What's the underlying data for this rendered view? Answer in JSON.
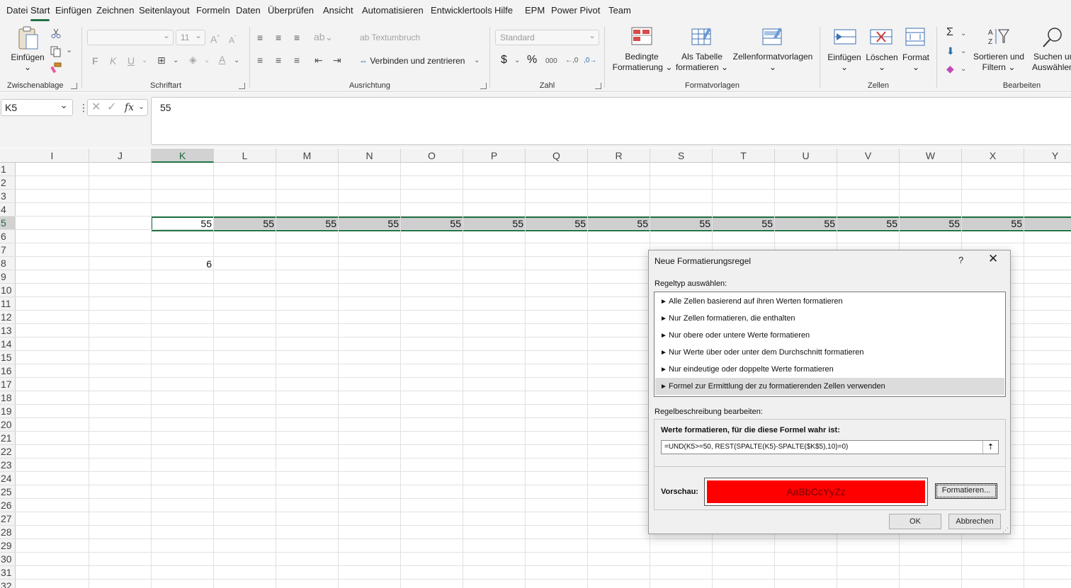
{
  "menu": {
    "tabs": [
      "Datei",
      "Start",
      "Einfügen",
      "Zeichnen",
      "Seitenlayout",
      "Formeln",
      "Daten",
      "Überprüfen",
      "Ansicht",
      "Automatisieren",
      "Entwicklertools",
      "Hilfe",
      "EPM",
      "Power Pivot",
      "Team"
    ],
    "active": "Start"
  },
  "ribbon": {
    "clipboard": {
      "paste": "Einfügen",
      "label": "Zwischenablage"
    },
    "font": {
      "size": "11",
      "bold": "F",
      "italic": "K",
      "underline": "U",
      "label": "Schriftart"
    },
    "alignment": {
      "wrap": "Textumbruch",
      "merge": "Verbinden und zentrieren",
      "label": "Ausrichtung"
    },
    "number": {
      "format": "Standard",
      "currency": "$",
      "percent": "%",
      "thousands": "000",
      "label": "Zahl"
    },
    "styles": {
      "conditional_1": "Bedingte",
      "conditional_2": "Formatierung",
      "table_1": "Als Tabelle",
      "table_2": "formatieren",
      "cellstyles": "Zellenformatvorlagen",
      "label": "Formatvorlagen"
    },
    "cells": {
      "insert": "Einfügen",
      "delete": "Löschen",
      "format": "Format",
      "label": "Zellen"
    },
    "editing": {
      "sort_1": "Sortieren und",
      "sort_2": "Filtern",
      "find_1": "Suchen und",
      "find_2": "Auswählen",
      "label": "Bearbeiten"
    }
  },
  "formula_bar": {
    "name_box": "K5",
    "content": "55",
    "fx": "fx"
  },
  "grid": {
    "columns": [
      "I",
      "J",
      "K",
      "L",
      "M",
      "N",
      "O",
      "P",
      "Q",
      "R",
      "S",
      "T",
      "U",
      "V",
      "W",
      "X",
      "Y"
    ],
    "selected_column": "K",
    "rows": [
      "1",
      "2",
      "3",
      "4",
      "5",
      "6",
      "7",
      "8",
      "9",
      "10",
      "11",
      "12",
      "13",
      "14",
      "15",
      "16",
      "17",
      "18",
      "19",
      "20",
      "21",
      "22",
      "23",
      "24",
      "25",
      "26",
      "27",
      "28",
      "29",
      "30",
      "31",
      "32"
    ],
    "selected_row": "5",
    "row5_values": [
      "55",
      "55",
      "55",
      "55",
      "55",
      "55",
      "55",
      "55",
      "55",
      "55",
      "55",
      "55",
      "55",
      "55"
    ],
    "k8_value": "6"
  },
  "dialog": {
    "title": "Neue Formatierungsregel",
    "help": "?",
    "close": "✕",
    "rule_type_label": "Regeltyp auswählen:",
    "rules": [
      "Alle Zellen basierend auf ihren Werten formatieren",
      "Nur Zellen formatieren, die enthalten",
      "Nur obere oder untere Werte formatieren",
      "Nur Werte über oder unter dem Durchschnitt formatieren",
      "Nur eindeutige oder doppelte Werte formatieren",
      "Formel zur Ermittlung der zu formatierenden Zellen verwenden"
    ],
    "selected_rule_index": 5,
    "edit_label": "Regelbeschreibung bearbeiten:",
    "formula_label": "Werte formatieren, für die diese Formel wahr ist:",
    "formula": "=UND(K5>=50, REST(SPALTE(K5)-SPALTE($K$5),10)=0)",
    "preview_label": "Vorschau:",
    "preview_text": "AaBbCcYyZz",
    "preview_color": "#ff0000",
    "format_button": "Formatieren...",
    "ok": "OK",
    "cancel": "Abbrechen"
  }
}
